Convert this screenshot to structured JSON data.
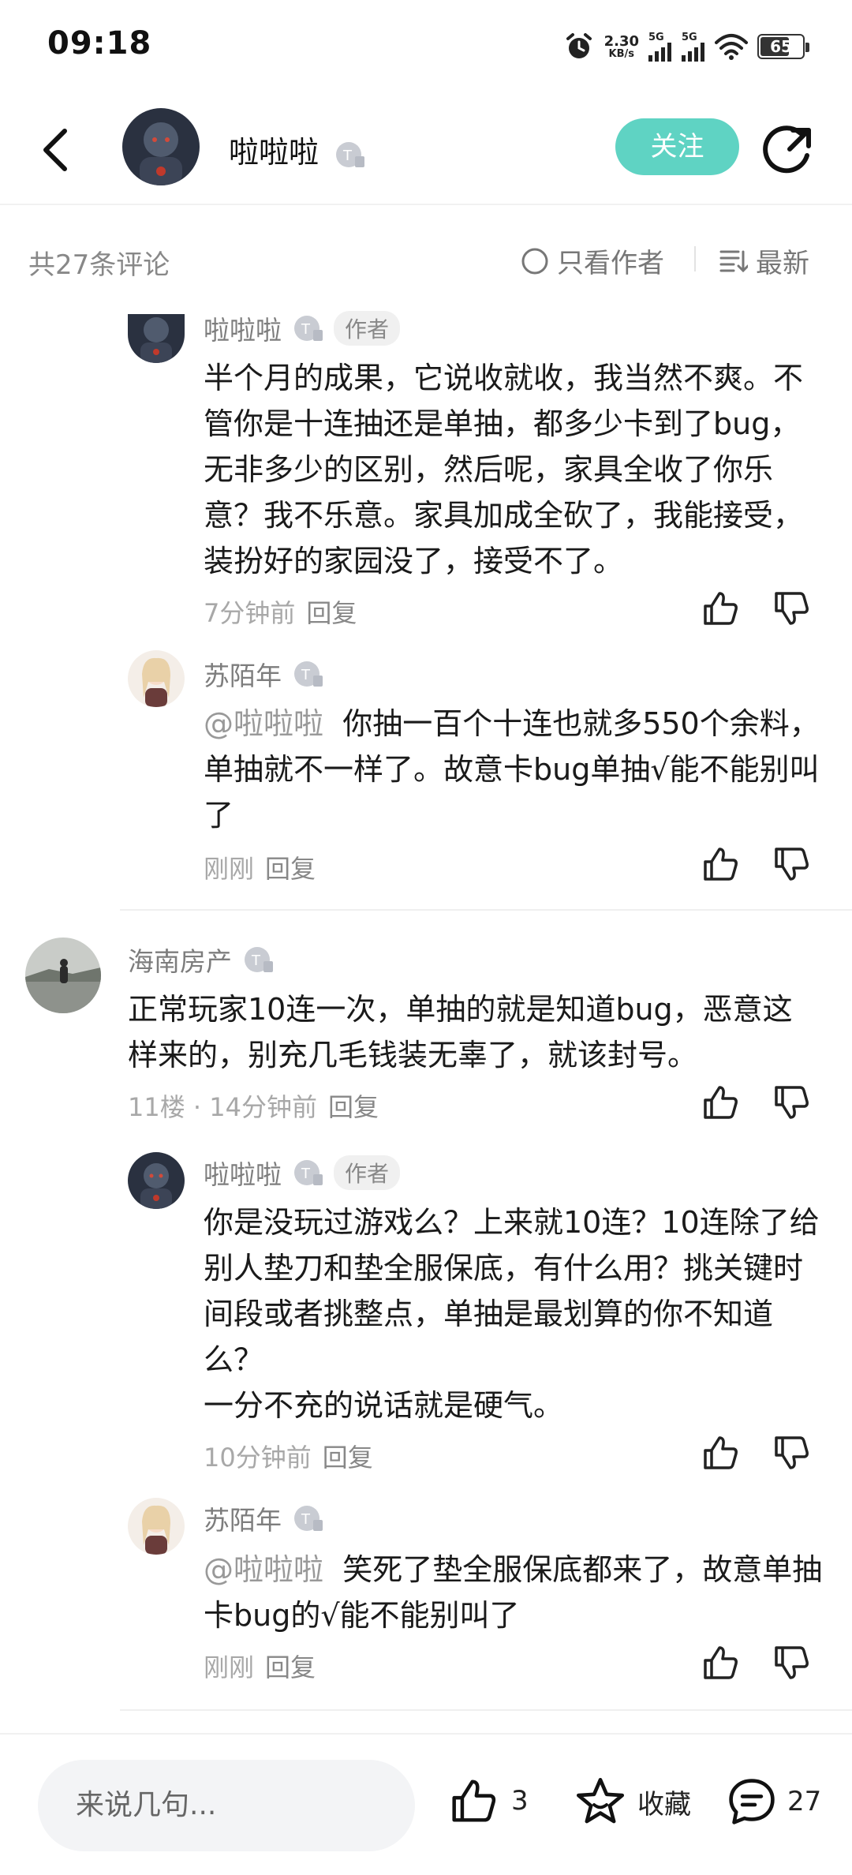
{
  "status_bar": {
    "time": "09:18",
    "net_speed": "2.30",
    "net_unit": "KB/s",
    "sig1": "5G",
    "sig2": "5G",
    "battery": "65"
  },
  "header": {
    "username": "啦啦啦",
    "follow_label": "关注",
    "accent_color": "#5fd3c3"
  },
  "comments_bar": {
    "count_label": "共27条评论",
    "only_author_label": "只看作者",
    "sort_label": "最新"
  },
  "comments": [
    {
      "name": "啦啦啦",
      "tag": "作者",
      "text": "半个月的成果，它说收就收，我当然不爽。不管你是十连抽还是单抽，都多少卡到了bug，无非多少的区别，然后呢，家具全收了你乐意？我不乐意。家具加成全砍了，我能接受，装扮好的家园没了，接受不了。",
      "time": "7分钟前",
      "reply": "回复"
    },
    {
      "name": "苏陌年",
      "mention": "@啦啦啦",
      "text": "你抽一百个十连也就多550个余料，单抽就不一样了。故意卡bug单抽√能不能别叫了",
      "time": "刚刚",
      "reply": "回复"
    },
    {
      "name": "海南房产",
      "text": "正常玩家10连一次，单抽的就是知道bug，恶意这样来的，别充几毛钱装无辜了，就该封号。",
      "floor": "11楼",
      "time": "14分钟前",
      "reply": "回复"
    },
    {
      "name": "啦啦啦",
      "tag": "作者",
      "text": "你是没玩过游戏么？上来就10连？10连除了给别人垫刀和垫全服保底，有什么用？挑关键时间段或者挑整点，单抽是最划算的你不知道么？\n一分不充的说话就是硬气。",
      "time": "10分钟前",
      "reply": "回复"
    },
    {
      "name": "苏陌年",
      "mention": "@啦啦啦",
      "text": "笑死了垫全服保底都来了，故意单抽卡bug的√能不能别叫了",
      "time": "刚刚",
      "reply": "回复"
    }
  ],
  "bottom_bar": {
    "input_placeholder": "来说几句...",
    "like_count": "3",
    "favorite_label": "收藏",
    "comment_count": "27"
  }
}
